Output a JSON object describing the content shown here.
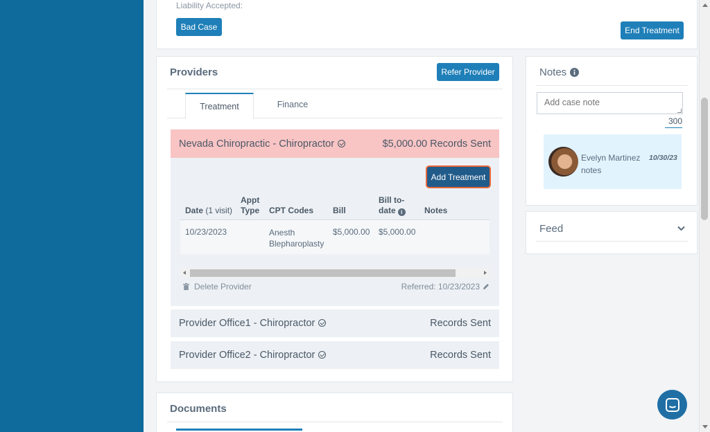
{
  "top": {
    "liability_label": "Liability Accepted:",
    "bad_case_label": "Bad Case",
    "end_treatment_label": "End Treatment"
  },
  "providers": {
    "title": "Providers",
    "refer_label": "Refer Provider",
    "tabs": [
      {
        "label": "Treatment",
        "active": true
      },
      {
        "label": "Finance",
        "active": false
      }
    ],
    "expanded": {
      "name": "Nevada Chiropractic - Chiropractor",
      "amount_status": "$5,000.00 Records Sent",
      "add_treatment_label": "Add Treatment",
      "headers": {
        "date": "Date",
        "visits": "(1 visit)",
        "appt1": "Appt",
        "appt2": "Type",
        "cpt": "CPT Codes",
        "bill": "Bill",
        "billto1": "Bill to-",
        "billto2": "date",
        "notes": "Notes"
      },
      "row": {
        "date": "10/23/2023",
        "appt": "",
        "cpt1": "Anesth",
        "cpt2": "Blepharoplasty",
        "bill": "$5,000.00",
        "billto": "$5,000.00",
        "notes": ""
      },
      "delete_label": "Delete Provider",
      "referred_label": "Referred: 10/23/2023"
    },
    "others": [
      {
        "name": "Provider Office1 - Chiropractor",
        "status": "Records Sent"
      },
      {
        "name": "Provider Office2 - Chiropractor",
        "status": "Records Sent"
      }
    ]
  },
  "documents": {
    "title": "Documents"
  },
  "notes": {
    "title": "Notes",
    "placeholder": "Add case note",
    "counter": "300",
    "entry": {
      "author": "Evelyn Martinez",
      "date": "10/30/23",
      "text": "notes"
    }
  },
  "feed": {
    "title": "Feed"
  },
  "colors": {
    "accent": "#1f7fb8",
    "sidebar": "#0e6b9b",
    "highlight": "#f8c4c4",
    "note_bg": "#e1f3fd"
  }
}
